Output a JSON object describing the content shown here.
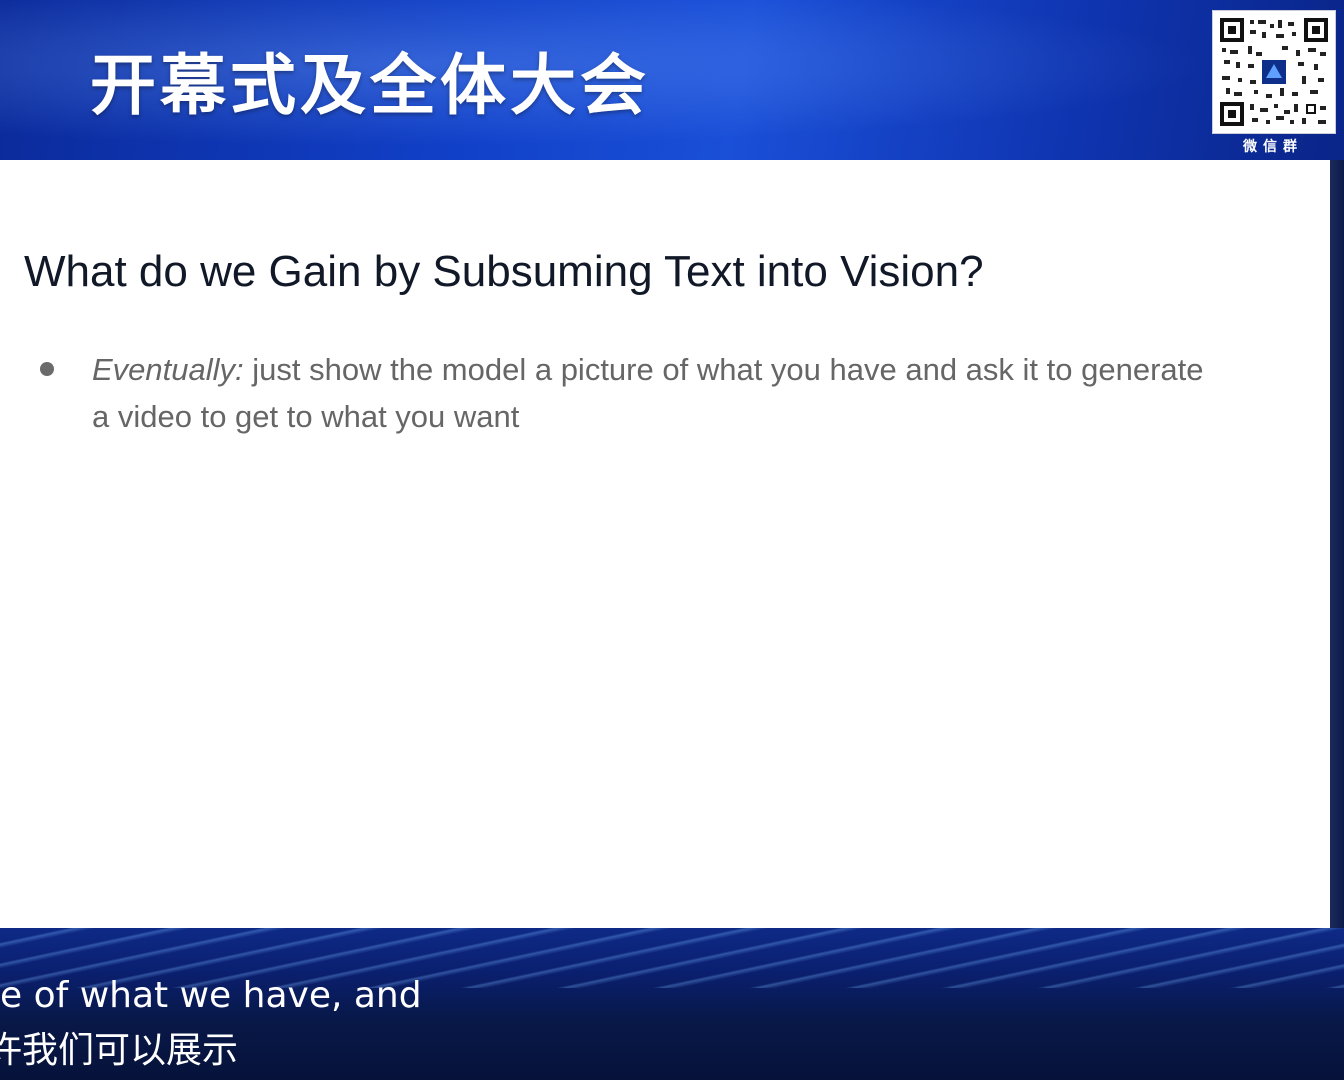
{
  "header": {
    "title": "开幕式及全体大会",
    "qr_label": "微信群",
    "qr_icon": "qr-code-icon"
  },
  "slide": {
    "title": "What do we Gain by Subsuming Text into Vision?",
    "bullets": [
      {
        "lead": "Eventually:",
        "text": " just show the model a picture of what you have and ask it to generate a video to get to what you want"
      }
    ]
  },
  "subtitles": {
    "english": "e of what we have, and",
    "chinese": "许我们可以展示"
  },
  "colors": {
    "header_blue": "#1a4fd8",
    "slide_bg": "#ffffff",
    "title_text": "#111827",
    "bullet_text": "#666666"
  }
}
